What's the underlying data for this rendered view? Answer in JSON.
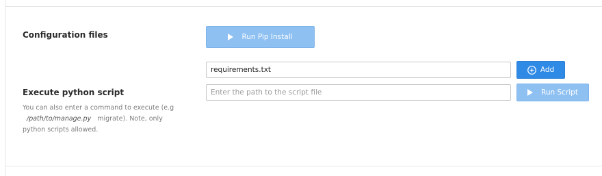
{
  "config": {
    "heading": "Configuration files",
    "pip_button_label": "Run Pip Install",
    "requirements_value": "requirements.txt",
    "add_button_label": "Add"
  },
  "execute": {
    "heading": "Execute python script",
    "help_prefix": "You can also enter a command to execute (e.g",
    "help_path": "/path/to/manage.py",
    "help_suffix": "migrate). Note, only python scripts allowed.",
    "script_placeholder": "Enter the path to the script file",
    "script_value": "",
    "run_button_label": "Run Script"
  },
  "icons": {
    "pip_button": "play-icon",
    "add_button": "plus-circle-icon",
    "run_button": "play-icon"
  },
  "colors": {
    "primary": "#2f8ae6",
    "primary_disabled": "#8ec0f2",
    "help_text": "#7d7d7d"
  }
}
